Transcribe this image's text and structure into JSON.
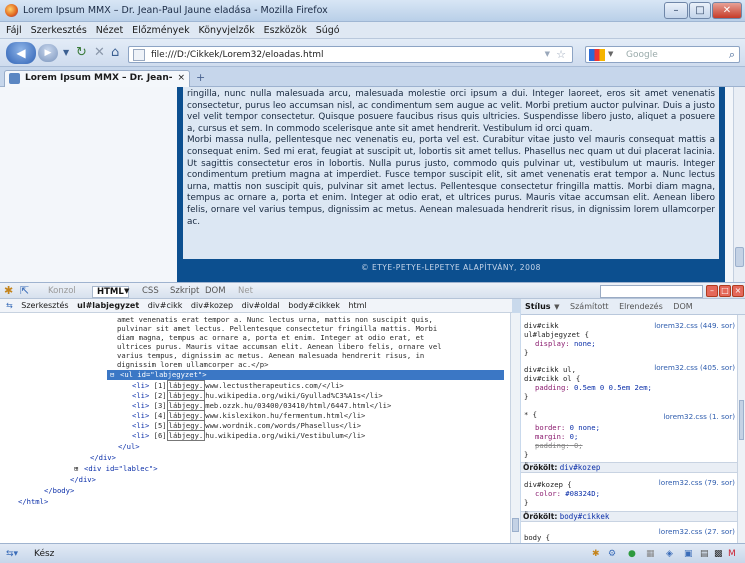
{
  "window": {
    "title": "Lorem Ipsum MMX – Dr. Jean-Paul Jaune eladása - Mozilla Firefox",
    "min": "–",
    "max": "□",
    "close": "✕"
  },
  "menu": [
    "Fájl",
    "Szerkesztés",
    "Nézet",
    "Előzmények",
    "Könyvjelzők",
    "Eszközök",
    "Súgó"
  ],
  "nav": {
    "url": "file:///D:/Cikkek/Lorem32/eloadas.html",
    "search_placeholder": "Google"
  },
  "tab": {
    "title": "Lorem Ipsum MMX – Dr. Jean-Pau...",
    "close": "×",
    "new": "+"
  },
  "page": {
    "p1": "ringilla, nunc nulla malesuada arcu, malesuada molestie orci ipsum a dui. Integer laoreet, eros sit amet venenatis consectetur, purus leo accumsan nisl, ac condimentum sem augue ac velit. Morbi pretium auctor pulvinar. Duis a justo vel velit tempor consectetur. Quisque posuere faucibus risus quis ultricies. Suspendisse libero justo, aliquet a posuere a, cursus et sem. In commodo scelerisque ante sit amet hendrerit. Vestibulum id orci quam.",
    "p2": "Morbi massa nulla, pellentesque nec venenatis eu, porta vel est. Curabitur vitae justo vel mauris consequat mattis a consequat enim. Sed mi erat, feugiat at suscipit ut, lobortis sit amet tellus. Phasellus nec quam ut dui placerat lacinia. Ut sagittis consectetur eros in lobortis. Nulla purus justo, commodo quis pulvinar ut, vestibulum ut mauris. Integer condimentum pretium magna at imperdiet. Fusce tempor suscipit elit, sit amet venenatis erat tempor a. Nunc lectus urna, mattis non suscipit quis, pulvinar sit amet lectus. Pellentesque consectetur fringilla mattis. Morbi diam magna, tempus ac ornare a, porta et enim. Integer at odio erat, et ultrices purus. Mauris vitae accumsan elit. Aenean libero felis, ornare vel varius tempus, dignissim ac metus. Aenean malesuada hendrerit risus, in dignissim lorem ullamcorper ac.",
    "footer": "© ETYE-PETYE-LEPETYE ALAPÍTVÁNY, 2008"
  },
  "firebug": {
    "tabs": [
      "Konzol",
      "HTML",
      "CSS",
      "Szkript",
      "DOM",
      "Net"
    ],
    "crumbs": [
      "Szerkesztés",
      "ul#labjegyzet",
      "div#cikk",
      "div#kozep",
      "div#oldal",
      "body#cikkek",
      "html"
    ],
    "side_tabs": [
      "Stílus",
      "Számított",
      "Elrendezés",
      "DOM"
    ],
    "html_lines": [
      "amet venenatis erat tempor a. Nunc lectus urna, mattis non suscipit quis,",
      "pulvinar sit amet lectus. Pellentesque consectetur fringilla mattis. Morbi",
      "diam magna, tempus ac ornare a, porta et enim. Integer at odio erat, et",
      "ultrices purus. Mauris vitae accumsan elit. Aenean libero felis, ornare vel",
      "varius tempus, dignissim ac metus. Aenean malesuada hendrerit risus, in",
      "dignissim lorem ullamcorper ac.</p>"
    ],
    "ul_open": "<ul id=\"labjegyzet\">",
    "li_items": [
      {
        "n": "[1]",
        "link": "lábjegy.",
        "url": "www.lectustherapeutics.com/</li>"
      },
      {
        "n": "[2]",
        "link": "lábjegy.",
        "url": "hu.wikipedia.org/wiki/Gyullad%C3%A1s</li>"
      },
      {
        "n": "[3]",
        "link": "lábjegy.",
        "url": "meb.ozzk.hu/03400/03410/html/6447.html</li>"
      },
      {
        "n": "[4]",
        "link": "lábjegy.",
        "url": "www.kislexikon.hu/fermentum.html</li>"
      },
      {
        "n": "[5]",
        "link": "lábjegy.",
        "url": "www.wordnik.com/words/Phasellus</li>"
      },
      {
        "n": "[6]",
        "link": "lábjegy.",
        "url": "hu.wikipedia.org/wiki/Vestibulum</li>"
      }
    ],
    "close_lines": [
      "</ul>",
      "</div>",
      "<div id=\"lablec\">",
      "</div>",
      "</body>",
      "</html>"
    ],
    "styles": {
      "r1_sel": "div#cikk",
      "r1_sel2": "ul#labjegyzet {",
      "r1_p": "display:",
      "r1_v": "none;",
      "r1_src": "lorem32.css (449. sor)",
      "r2_sel": "div#cikk ul,",
      "r2_sel2": "div#cikk ol {",
      "r2_p": "padding:",
      "r2_v": "0.5em 0 0.5em 2em;",
      "r2_src": "lorem32.css (405. sor)",
      "r3_sel": "* {",
      "r3_p1": "border:",
      "r3_v1": "0 none;",
      "r3_p2": "margin:",
      "r3_v2": "0;",
      "r3_p3": "padding:",
      "r3_v3": "0;",
      "r3_src": "lorem32.css (1. sor)",
      "inh1_label": "Örökölt:",
      "inh1": "div#kozep",
      "r4_sel": "div#kozep {",
      "r4_p": "color:",
      "r4_v": "#08324D;",
      "r4_src": "lorem32.css (79. sor)",
      "inh2_label": "Örökölt:",
      "inh2": "body#cikkek",
      "r5_sel": "body {",
      "r5_src": "lorem32.css (27. sor)",
      "close": "}"
    }
  },
  "status": {
    "text": "Kész"
  }
}
